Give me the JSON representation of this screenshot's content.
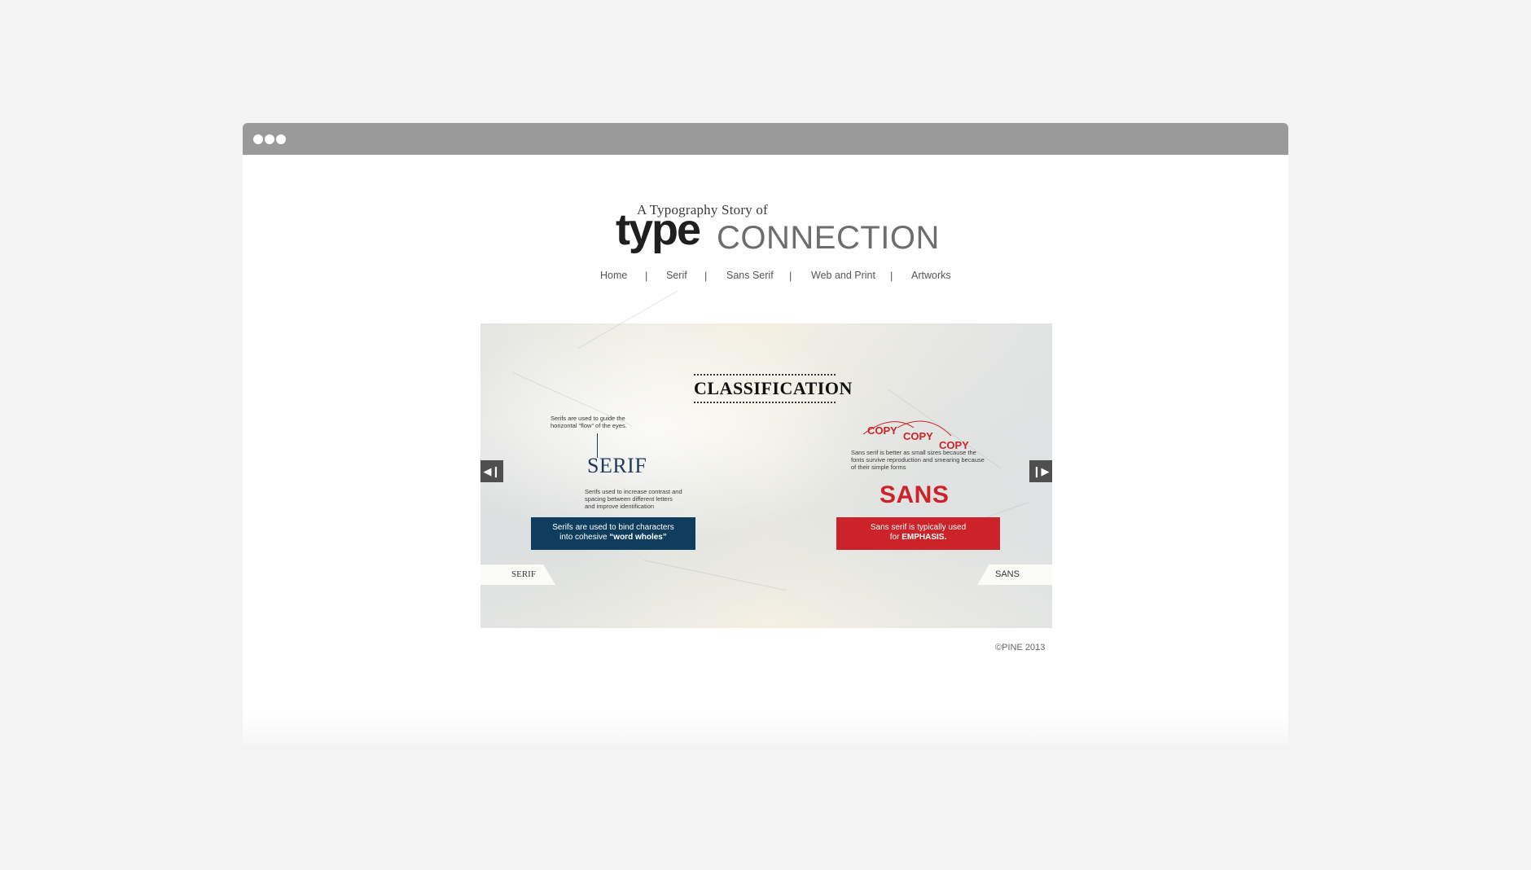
{
  "window": {
    "titlebar_dots": [
      "dot-1",
      "dot-2",
      "dot-3"
    ]
  },
  "logo": {
    "subtitle": "A Typography Story of",
    "type_word": "type",
    "connection_word": "CONNECTION"
  },
  "nav": {
    "items": [
      "Home",
      "Serif",
      "Sans Serif",
      "Web and Print",
      "Artworks"
    ],
    "separator": "|"
  },
  "slide": {
    "title": "CLASSIFICATION",
    "serif": {
      "note_top": "Serifs are used to guide the horizontal “flow” of the eyes.",
      "word": "SERIF",
      "note_bottom": "Serifs used to increase contrast and spacing between different letters and improve identification",
      "box_line1": "Serifs are used to bind characters",
      "box_line2_prefix": "into cohesive ",
      "box_line2_bold": "“word wholes”",
      "tab": "SERIF"
    },
    "sans": {
      "copies": [
        "COPY",
        "COPY",
        "COPY"
      ],
      "note": "Sans serif is better as small sizes because the fonts survive reproduction and smearing because of their simple forms",
      "word": "SANS",
      "box_line1": "Sans serif is typically used",
      "box_line2_prefix": "for ",
      "box_line2_bold": "EMPHASIS.",
      "tab": "SANS"
    },
    "prev_icon": "prev-arrow-icon",
    "next_icon": "next-arrow-icon"
  },
  "footer": {
    "copyright": "©PINE 2013"
  },
  "colors": {
    "serif_blue": "#0f3d5e",
    "sans_red": "#cc2229",
    "titlebar": "#9a9a9a"
  }
}
